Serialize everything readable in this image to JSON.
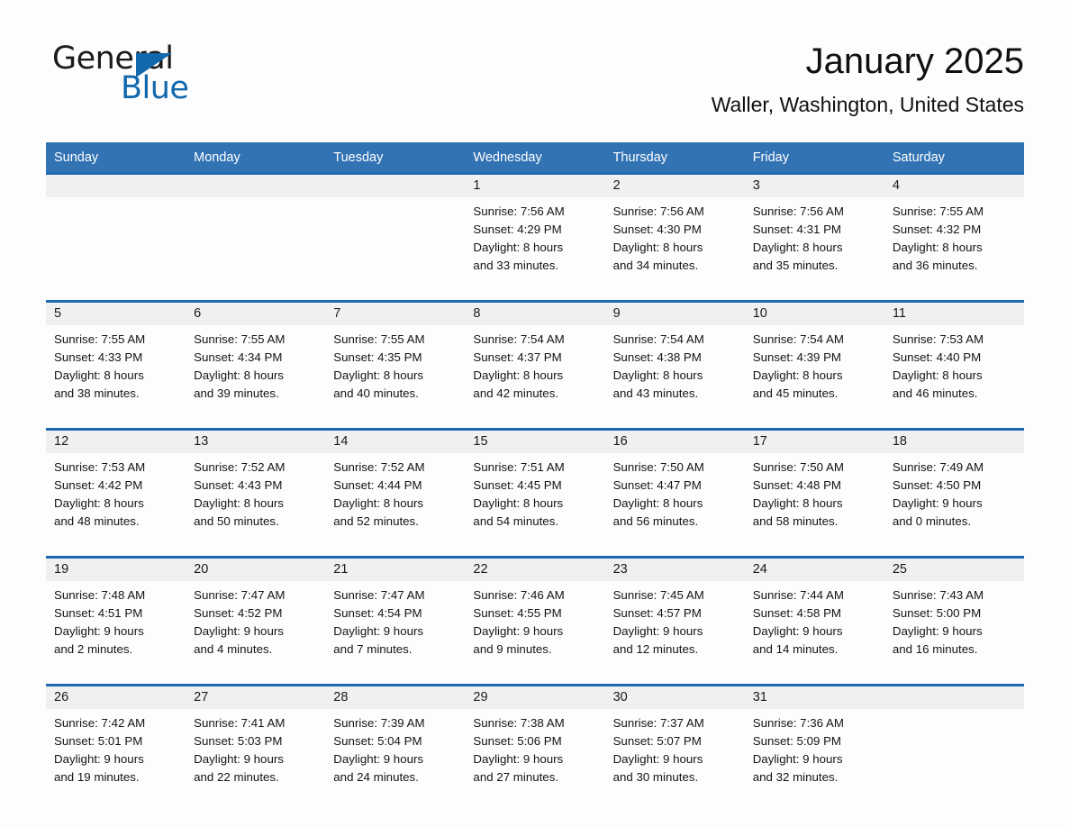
{
  "logo": {
    "primary_text": "General",
    "secondary_text": "Blue",
    "accent_color": "#1168ad",
    "triangle_icon": "triangle-icon"
  },
  "header": {
    "title": "January 2025",
    "subtitle": "Waller, Washington, United States"
  },
  "colors": {
    "header_blue": "#3273b4",
    "row_divider_blue": "#1f69b3",
    "daynum_band": "#f0f0f0",
    "page_background": "#fdfdfd",
    "text": "#141414"
  },
  "calendar": {
    "weekday_headers": [
      "Sunday",
      "Monday",
      "Tuesday",
      "Wednesday",
      "Thursday",
      "Friday",
      "Saturday"
    ],
    "weeks": [
      [
        {
          "day": "",
          "lines": []
        },
        {
          "day": "",
          "lines": []
        },
        {
          "day": "",
          "lines": []
        },
        {
          "day": "1",
          "lines": [
            "Sunrise: 7:56 AM",
            "Sunset: 4:29 PM",
            "Daylight: 8 hours",
            "and 33 minutes."
          ]
        },
        {
          "day": "2",
          "lines": [
            "Sunrise: 7:56 AM",
            "Sunset: 4:30 PM",
            "Daylight: 8 hours",
            "and 34 minutes."
          ]
        },
        {
          "day": "3",
          "lines": [
            "Sunrise: 7:56 AM",
            "Sunset: 4:31 PM",
            "Daylight: 8 hours",
            "and 35 minutes."
          ]
        },
        {
          "day": "4",
          "lines": [
            "Sunrise: 7:55 AM",
            "Sunset: 4:32 PM",
            "Daylight: 8 hours",
            "and 36 minutes."
          ]
        }
      ],
      [
        {
          "day": "5",
          "lines": [
            "Sunrise: 7:55 AM",
            "Sunset: 4:33 PM",
            "Daylight: 8 hours",
            "and 38 minutes."
          ]
        },
        {
          "day": "6",
          "lines": [
            "Sunrise: 7:55 AM",
            "Sunset: 4:34 PM",
            "Daylight: 8 hours",
            "and 39 minutes."
          ]
        },
        {
          "day": "7",
          "lines": [
            "Sunrise: 7:55 AM",
            "Sunset: 4:35 PM",
            "Daylight: 8 hours",
            "and 40 minutes."
          ]
        },
        {
          "day": "8",
          "lines": [
            "Sunrise: 7:54 AM",
            "Sunset: 4:37 PM",
            "Daylight: 8 hours",
            "and 42 minutes."
          ]
        },
        {
          "day": "9",
          "lines": [
            "Sunrise: 7:54 AM",
            "Sunset: 4:38 PM",
            "Daylight: 8 hours",
            "and 43 minutes."
          ]
        },
        {
          "day": "10",
          "lines": [
            "Sunrise: 7:54 AM",
            "Sunset: 4:39 PM",
            "Daylight: 8 hours",
            "and 45 minutes."
          ]
        },
        {
          "day": "11",
          "lines": [
            "Sunrise: 7:53 AM",
            "Sunset: 4:40 PM",
            "Daylight: 8 hours",
            "and 46 minutes."
          ]
        }
      ],
      [
        {
          "day": "12",
          "lines": [
            "Sunrise: 7:53 AM",
            "Sunset: 4:42 PM",
            "Daylight: 8 hours",
            "and 48 minutes."
          ]
        },
        {
          "day": "13",
          "lines": [
            "Sunrise: 7:52 AM",
            "Sunset: 4:43 PM",
            "Daylight: 8 hours",
            "and 50 minutes."
          ]
        },
        {
          "day": "14",
          "lines": [
            "Sunrise: 7:52 AM",
            "Sunset: 4:44 PM",
            "Daylight: 8 hours",
            "and 52 minutes."
          ]
        },
        {
          "day": "15",
          "lines": [
            "Sunrise: 7:51 AM",
            "Sunset: 4:45 PM",
            "Daylight: 8 hours",
            "and 54 minutes."
          ]
        },
        {
          "day": "16",
          "lines": [
            "Sunrise: 7:50 AM",
            "Sunset: 4:47 PM",
            "Daylight: 8 hours",
            "and 56 minutes."
          ]
        },
        {
          "day": "17",
          "lines": [
            "Sunrise: 7:50 AM",
            "Sunset: 4:48 PM",
            "Daylight: 8 hours",
            "and 58 minutes."
          ]
        },
        {
          "day": "18",
          "lines": [
            "Sunrise: 7:49 AM",
            "Sunset: 4:50 PM",
            "Daylight: 9 hours",
            "and 0 minutes."
          ]
        }
      ],
      [
        {
          "day": "19",
          "lines": [
            "Sunrise: 7:48 AM",
            "Sunset: 4:51 PM",
            "Daylight: 9 hours",
            "and 2 minutes."
          ]
        },
        {
          "day": "20",
          "lines": [
            "Sunrise: 7:47 AM",
            "Sunset: 4:52 PM",
            "Daylight: 9 hours",
            "and 4 minutes."
          ]
        },
        {
          "day": "21",
          "lines": [
            "Sunrise: 7:47 AM",
            "Sunset: 4:54 PM",
            "Daylight: 9 hours",
            "and 7 minutes."
          ]
        },
        {
          "day": "22",
          "lines": [
            "Sunrise: 7:46 AM",
            "Sunset: 4:55 PM",
            "Daylight: 9 hours",
            "and 9 minutes."
          ]
        },
        {
          "day": "23",
          "lines": [
            "Sunrise: 7:45 AM",
            "Sunset: 4:57 PM",
            "Daylight: 9 hours",
            "and 12 minutes."
          ]
        },
        {
          "day": "24",
          "lines": [
            "Sunrise: 7:44 AM",
            "Sunset: 4:58 PM",
            "Daylight: 9 hours",
            "and 14 minutes."
          ]
        },
        {
          "day": "25",
          "lines": [
            "Sunrise: 7:43 AM",
            "Sunset: 5:00 PM",
            "Daylight: 9 hours",
            "and 16 minutes."
          ]
        }
      ],
      [
        {
          "day": "26",
          "lines": [
            "Sunrise: 7:42 AM",
            "Sunset: 5:01 PM",
            "Daylight: 9 hours",
            "and 19 minutes."
          ]
        },
        {
          "day": "27",
          "lines": [
            "Sunrise: 7:41 AM",
            "Sunset: 5:03 PM",
            "Daylight: 9 hours",
            "and 22 minutes."
          ]
        },
        {
          "day": "28",
          "lines": [
            "Sunrise: 7:39 AM",
            "Sunset: 5:04 PM",
            "Daylight: 9 hours",
            "and 24 minutes."
          ]
        },
        {
          "day": "29",
          "lines": [
            "Sunrise: 7:38 AM",
            "Sunset: 5:06 PM",
            "Daylight: 9 hours",
            "and 27 minutes."
          ]
        },
        {
          "day": "30",
          "lines": [
            "Sunrise: 7:37 AM",
            "Sunset: 5:07 PM",
            "Daylight: 9 hours",
            "and 30 minutes."
          ]
        },
        {
          "day": "31",
          "lines": [
            "Sunrise: 7:36 AM",
            "Sunset: 5:09 PM",
            "Daylight: 9 hours",
            "and 32 minutes."
          ]
        },
        {
          "day": "",
          "lines": []
        }
      ]
    ]
  }
}
